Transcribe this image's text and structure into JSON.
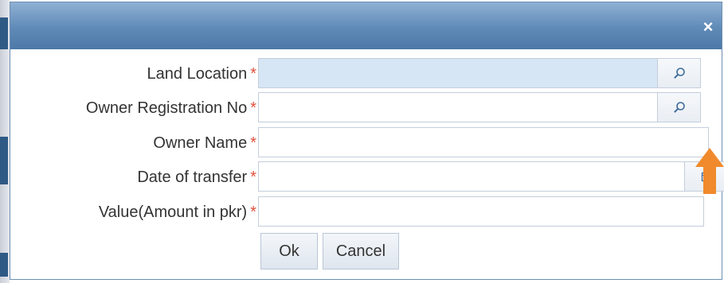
{
  "dialog": {
    "close_glyph": "×"
  },
  "form": {
    "required_mark": "*",
    "fields": [
      {
        "label": "Land Location",
        "value": "",
        "icon": "search-icon"
      },
      {
        "label": "Owner Registration No",
        "value": "",
        "icon": "search-icon"
      },
      {
        "label": "Owner Name",
        "value": ""
      },
      {
        "label": "Date of transfer",
        "value": "",
        "icon": "calendar-icon"
      },
      {
        "label": "Value(Amount in pkr)",
        "value": ""
      }
    ]
  },
  "buttons": {
    "ok_label": "Ok",
    "cancel_label": "Cancel"
  },
  "colors": {
    "titlebar": "#5f8ab7",
    "required": "#e0503c",
    "highlight_field": "#d7e6f5",
    "arrow": "#f08a2c"
  }
}
